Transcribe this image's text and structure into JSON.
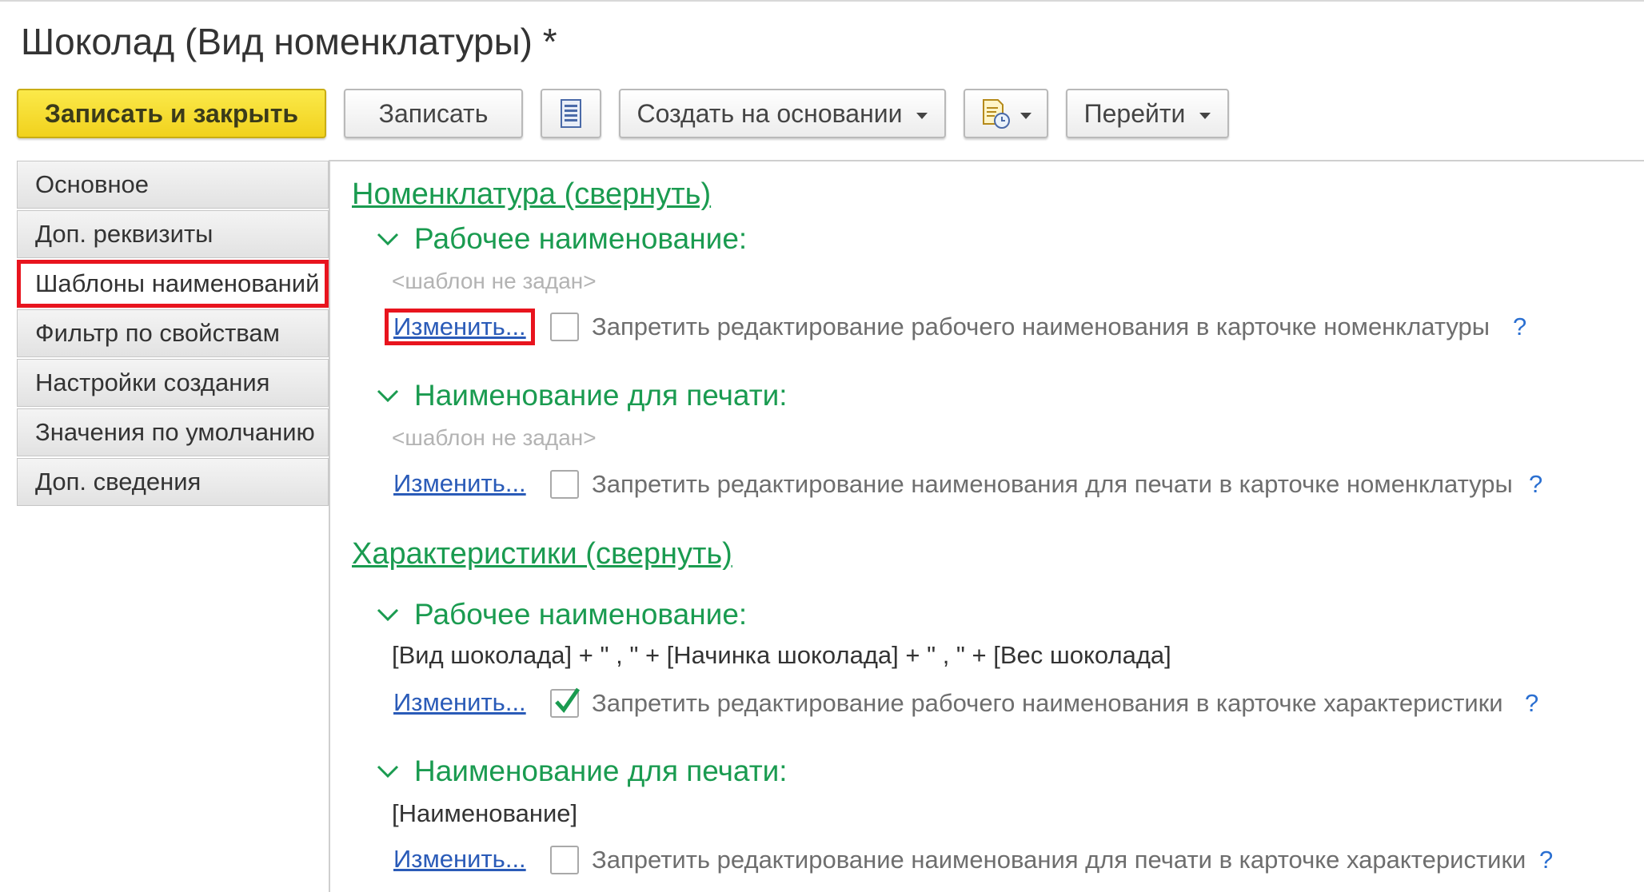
{
  "window": {
    "title": "Шоколад (Вид номенклатуры) *"
  },
  "toolbar": {
    "save_close_label": "Записать и закрыть",
    "save_label": "Записать",
    "create_based_label": "Создать на основании",
    "goto_label": "Перейти"
  },
  "sidebar": {
    "items": [
      {
        "label": "Основное"
      },
      {
        "label": "Доп. реквизиты"
      },
      {
        "label": "Шаблоны наименований"
      },
      {
        "label": "Фильтр по свойствам"
      },
      {
        "label": "Настройки создания"
      },
      {
        "label": "Значения по умолчанию"
      },
      {
        "label": "Доп. сведения"
      }
    ],
    "active_item": "Шаблоны наименований"
  },
  "nomenclature": {
    "section_link": "Номенклатура (свернуть)",
    "working": {
      "title": "Рабочее наименование:",
      "template": "<шаблон не задан>",
      "change_link": "Изменить...",
      "checkbox_checked": false,
      "checkbox_label": "Запретить редактирование рабочего наименования в карточке номенклатуры",
      "help": "?"
    },
    "print": {
      "title": "Наименование для печати:",
      "template": "<шаблон не задан>",
      "change_link": "Изменить...",
      "checkbox_checked": false,
      "checkbox_label": "Запретить редактирование наименования для печати в карточке номенклатуры",
      "help": "?"
    }
  },
  "characteristics": {
    "section_link": "Характеристики (свернуть)",
    "working": {
      "title": "Рабочее наименование:",
      "template": "[Вид шоколада] + \" , \" + [Начинка шоколада] + \" , \" + [Вес шоколада]",
      "change_link": "Изменить...",
      "checkbox_checked": true,
      "checkbox_label": "Запретить редактирование рабочего наименования в карточке характеристики",
      "help": "?"
    },
    "print": {
      "title": "Наименование для печати:",
      "template": "[Наименование]",
      "change_link": "Изменить...",
      "checkbox_checked": false,
      "checkbox_label": "Запретить редактирование наименования для печати в карточке характеристики",
      "help": "?"
    }
  },
  "colors": {
    "accent_green": "#1a9b50",
    "link_blue": "#2a5bb8",
    "primary_yellow": "#f1d21d",
    "highlight_red": "#e8141e"
  },
  "icons": {
    "list": "list-icon",
    "report": "report-clock-icon",
    "expand": "chevron-down-icon",
    "check": "checkmark-icon"
  }
}
